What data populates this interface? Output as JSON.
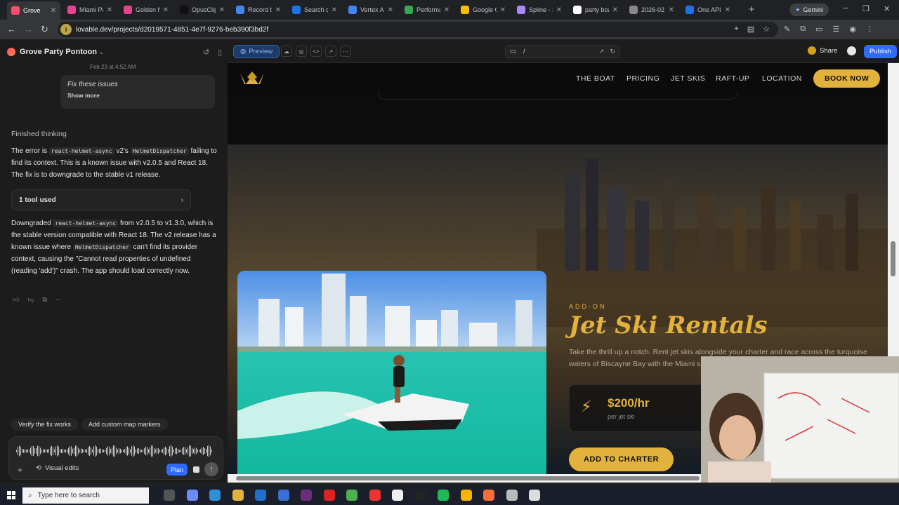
{
  "browser": {
    "tabs": [
      {
        "title": "Grove",
        "active": true,
        "color": "#ff4d6d"
      },
      {
        "title": "Miami Pa",
        "color": "#e84393"
      },
      {
        "title": "Golden M",
        "color": "#e84393"
      },
      {
        "title": "OpusClip",
        "color": "#111111"
      },
      {
        "title": "Record b",
        "color": "#4285f4"
      },
      {
        "title": "Search co",
        "color": "#1a73e8"
      },
      {
        "title": "Vertex AI",
        "color": "#4285f4"
      },
      {
        "title": "Performa",
        "color": "#34a853"
      },
      {
        "title": "Google C",
        "color": "#fbbc04"
      },
      {
        "title": "Spline - 3",
        "color": "#a78bfa"
      },
      {
        "title": "party boa",
        "color": "#ffffff"
      },
      {
        "title": "2026-02",
        "color": "#888888"
      },
      {
        "title": "One API",
        "color": "#1a73e8"
      }
    ],
    "gemini_label": "Gemini",
    "url": "lovable.dev/projects/d2019571-4851-4e7f-9276-beb390f3bd2f"
  },
  "chat": {
    "project_name": "Grove Party Pontoon",
    "timestamp": "Feb 23 at 4:52 AM",
    "user_message": "Fix these issues",
    "show_more": "Show more",
    "thinking_label": "Finished thinking",
    "para1": {
      "pre": "The error is ",
      "code1": "react-helmet-async",
      "mid": " v2's ",
      "code2": "HelmetDispatcher",
      "post": " failing to find its context. This is a known issue with v2.0.5 and React 18. The fix is to downgrade to the stable v1 release."
    },
    "tool_used": "1 tool used",
    "para2": {
      "pre": "Downgraded ",
      "code1": "react-helmet-async",
      "mid": " from v2.0.5 to v1.3.0, which is the stable version compatible with React 18. The v2 release has a known issue where ",
      "code2": "HelmetDispatcher",
      "post": " can't find its provider context, causing the \"Cannot read properties of undefined (reading 'add')\" crash. The app should load correctly now."
    },
    "suggestions": [
      "Verify the fix works",
      "Add custom map markers"
    ],
    "visual_edits": "Visual edits",
    "plan_label": "Plan"
  },
  "preview_toolbar": {
    "preview_label": "Preview",
    "path": "/",
    "share_label": "Share",
    "publish_label": "Publish"
  },
  "site": {
    "nav": [
      "THE BOAT",
      "PRICING",
      "JET SKIS",
      "RAFT-UP",
      "LOCATION"
    ],
    "book_now": "BOOK NOW",
    "addon_label": "ADD-ON",
    "heading": "Jet Ski Rentals",
    "description": "Take the thrill up a notch. Rent jet skis alongside your charter and race across the turquoise waters of Biscayne Bay with the Miami skyline as your backdrop.",
    "price": "$200/hr",
    "price_sub": "per jet ski",
    "cta": "ADD TO CHARTER",
    "accent": "#e3b23c"
  },
  "taskbar": {
    "search_placeholder": "Type here to search"
  }
}
